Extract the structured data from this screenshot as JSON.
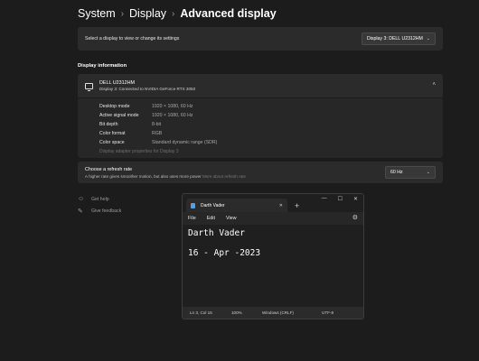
{
  "breadcrumb": {
    "level1": "System",
    "level2": "Display",
    "current": "Advanced display",
    "separator": "›"
  },
  "display_select": {
    "label": "Select a display to view or change its settings",
    "value": "Display 3: DELL U2312HM"
  },
  "display_info": {
    "title": "Display information",
    "monitor_name": "DELL U2312HM",
    "monitor_sub": "Display 3: Connected to NVIDIA GeForce RTX 3050",
    "rows": [
      {
        "label": "Desktop mode",
        "value": "1920 × 1080, 60 Hz"
      },
      {
        "label": "Active signal mode",
        "value": "1920 × 1080, 60 Hz"
      },
      {
        "label": "Bit depth",
        "value": "8-bit"
      },
      {
        "label": "Color format",
        "value": "RGB"
      },
      {
        "label": "Color space",
        "value": "Standard dynamic range (SDR)"
      }
    ],
    "adapter_link": "Display adapter properties for Display 3"
  },
  "refresh_rate": {
    "title": "Choose a refresh rate",
    "desc": "A higher rate gives smoother motion, but also uses more power",
    "link": "More about refresh rate",
    "value": "60 Hz"
  },
  "help_links": {
    "get_help": "Get help",
    "give_feedback": "Give feedback"
  },
  "notepad": {
    "tab_title": "Darth Vader",
    "menu": {
      "file": "File",
      "edit": "Edit",
      "view": "View"
    },
    "content_line1": "Darth Vader",
    "content_line2": "16 - Apr -2023",
    "status": {
      "position": "Ln 3, Col 15",
      "zoom": "100%",
      "line_ending": "Windows (CRLF)",
      "encoding": "UTF-8"
    }
  },
  "icons": {
    "chevron_down": "⌄",
    "chevron_up": "˄",
    "close": "✕",
    "plus": "+",
    "minimize": "—",
    "maximize": "☐",
    "gear": "⚙",
    "help": "☺",
    "feedback": "✎"
  }
}
